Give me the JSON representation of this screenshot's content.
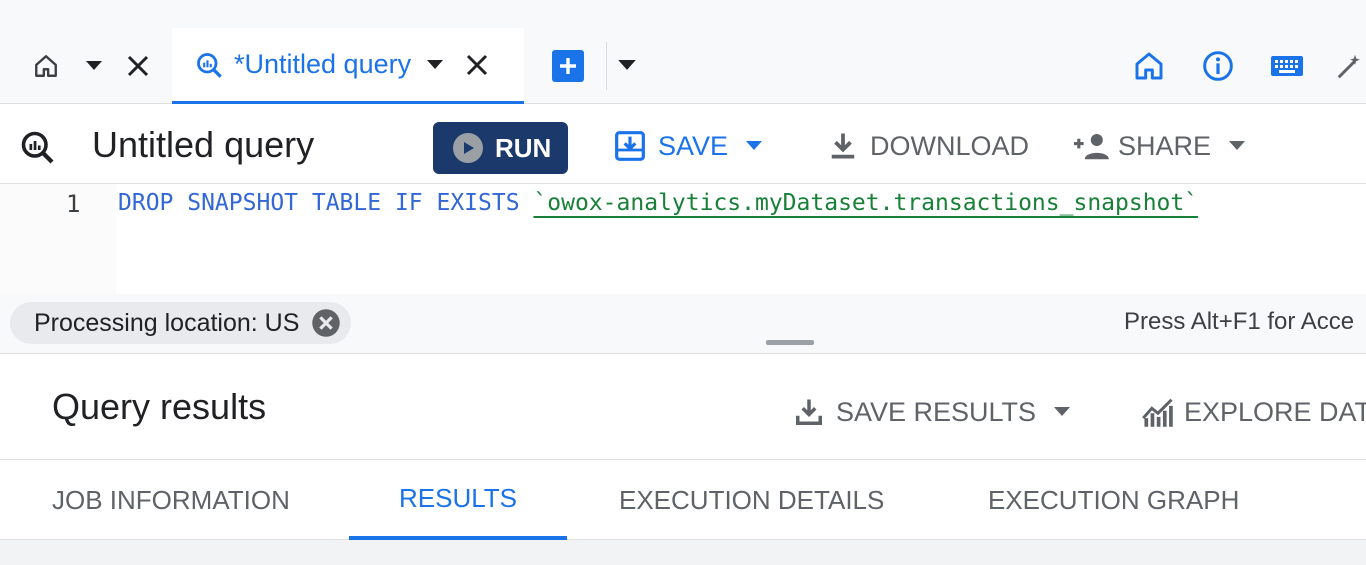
{
  "tabs": {
    "home": {
      "icon": "home-icon"
    },
    "query": {
      "title": "*Untitled query"
    }
  },
  "toolbar": {
    "title": "Untitled query",
    "run_label": "RUN",
    "save_label": "SAVE",
    "download_label": "DOWNLOAD",
    "share_label": "SHARE"
  },
  "editor": {
    "line_number": "1",
    "keywords": "DROP SNAPSHOT TABLE IF EXISTS",
    "table_ref": "`owox-analytics.myDataset.transactions_snapshot`"
  },
  "location": {
    "chip_label": "Processing location: US",
    "hint": "Press Alt+F1 for Acce"
  },
  "results": {
    "title": "Query results",
    "save_results_label": "SAVE RESULTS",
    "explore_label": "EXPLORE DATA",
    "tabs": [
      {
        "label": "JOB INFORMATION",
        "active": false
      },
      {
        "label": "RESULTS",
        "active": true
      },
      {
        "label": "EXECUTION DETAILS",
        "active": false
      },
      {
        "label": "EXECUTION GRAPH",
        "active": false
      }
    ]
  },
  "colors": {
    "accent": "#1a73e8",
    "run_button": "#1b3a6b",
    "string": "#188038",
    "keyword": "#3367d6"
  }
}
